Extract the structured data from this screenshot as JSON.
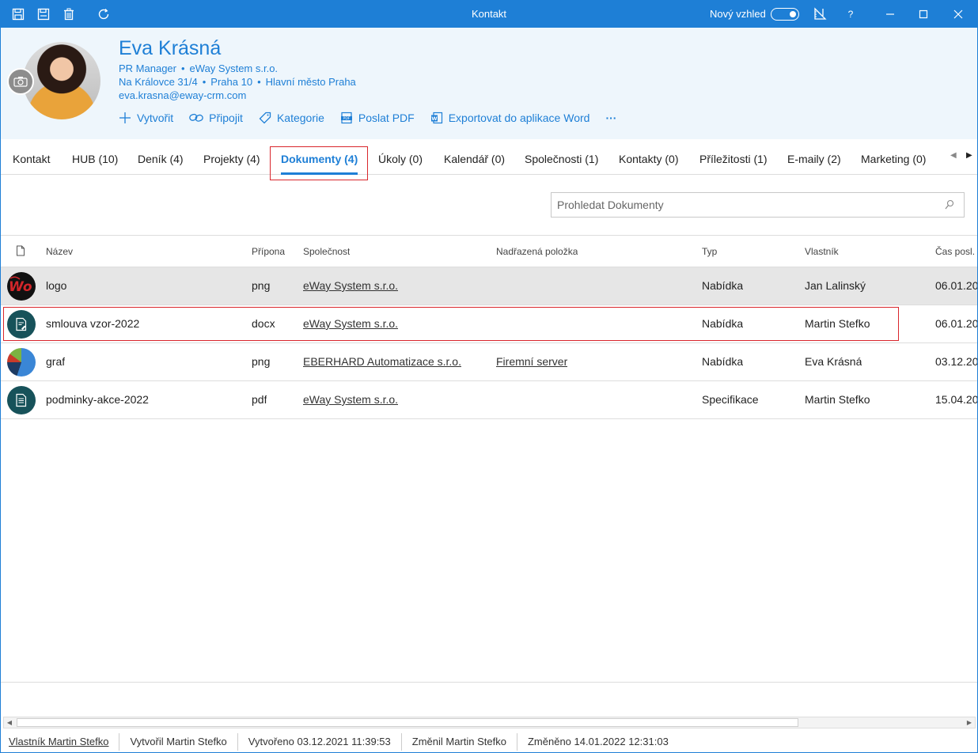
{
  "window": {
    "title": "Kontakt",
    "new_look_label": "Nový vzhled",
    "help_label": "?"
  },
  "contact": {
    "name": "Eva Krásná",
    "position": "PR Manager",
    "company": "eWay System s.r.o.",
    "street": "Na Královce 31/4",
    "district": "Praha 10",
    "region": "Hlavní město Praha",
    "email": "eva.krasna@eway-crm.com"
  },
  "actions": {
    "create": "Vytvořit",
    "connect": "Připojit",
    "category": "Kategorie",
    "send_pdf": "Poslat PDF",
    "export_word": "Exportovat do aplikace Word",
    "more": "···"
  },
  "tabs": [
    {
      "label": "Kontakt"
    },
    {
      "label": "HUB (10)"
    },
    {
      "label": "Deník (4)"
    },
    {
      "label": "Projekty (4)"
    },
    {
      "label": "Dokumenty (4)"
    },
    {
      "label": "Úkoly (0)"
    },
    {
      "label": "Kalendář (0)"
    },
    {
      "label": "Společnosti (1)"
    },
    {
      "label": "Kontakty (0)"
    },
    {
      "label": "Příležitosti (1)"
    },
    {
      "label": "E-maily (2)"
    },
    {
      "label": "Marketing (0)"
    }
  ],
  "search": {
    "placeholder": "Prohledat Dokumenty"
  },
  "grid": {
    "columns": {
      "name": "Název",
      "ext": "Přípona",
      "company": "Společnost",
      "parent": "Nadřazená položka",
      "type": "Typ",
      "owner": "Vlastník",
      "modified": "Čas posl. z"
    },
    "rows": [
      {
        "name": "logo",
        "ext": "png",
        "company": "eWay System s.r.o.",
        "parent": "",
        "type": "Nabídka",
        "owner": "Jan Lalinský",
        "modified": "06.01.20"
      },
      {
        "name": "smlouva vzor-2022",
        "ext": "docx",
        "company": "eWay System s.r.o.",
        "parent": "",
        "type": "Nabídka",
        "owner": "Martin Stefko",
        "modified": "06.01.20"
      },
      {
        "name": "graf",
        "ext": "png",
        "company": "EBERHARD Automatizace s.r.o.",
        "parent": "Firemní server",
        "type": "Nabídka",
        "owner": "Eva Krásná",
        "modified": "03.12.20"
      },
      {
        "name": "podminky-akce-2022",
        "ext": "pdf",
        "company": "eWay System s.r.o.",
        "parent": "",
        "type": "Specifikace",
        "owner": "Martin Stefko",
        "modified": "15.04.20"
      }
    ]
  },
  "status": {
    "owner": "Vlastník Martin Stefko",
    "created_by": "Vytvořil Martin Stefko",
    "created": "Vytvořeno 03.12.2021 11:39:53",
    "changed_by": "Změnil Martin Stefko",
    "changed": "Změněno 14.01.2022 12:31:03"
  },
  "colors": {
    "accent": "#1e7fd6",
    "highlight": "#d9262c",
    "header_bg": "#eef6fc"
  },
  "icons": {
    "toolbar": [
      "save-icon",
      "save-close-icon",
      "delete-icon",
      "refresh-icon"
    ],
    "title": [
      "ruler-icon",
      "minimize-icon",
      "maximize-icon",
      "close-icon"
    ]
  }
}
